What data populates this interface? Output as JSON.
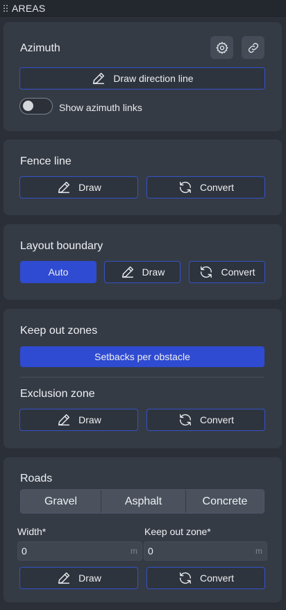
{
  "panel": {
    "title": "AREAS"
  },
  "azimuth": {
    "heading": "Azimuth",
    "draw_label": "Draw direction line",
    "toggle_label": "Show azimuth links",
    "toggle_on": false
  },
  "fence": {
    "heading": "Fence line",
    "draw_label": "Draw",
    "convert_label": "Convert"
  },
  "layout": {
    "heading": "Layout boundary",
    "auto_label": "Auto",
    "draw_label": "Draw",
    "convert_label": "Convert"
  },
  "keepout": {
    "heading": "Keep out zones",
    "setbacks_label": "Setbacks per obstacle"
  },
  "exclusion": {
    "heading": "Exclusion zone",
    "draw_label": "Draw",
    "convert_label": "Convert"
  },
  "roads": {
    "heading": "Roads",
    "types": [
      "Gravel",
      "Asphalt",
      "Concrete"
    ],
    "width_label": "Width*",
    "width_value": "0",
    "width_unit": "m",
    "keepout_label": "Keep out zone*",
    "keepout_value": "0",
    "keepout_unit": "m",
    "draw_label": "Draw",
    "convert_label": "Convert"
  },
  "colors": {
    "accent": "#2f4bd1",
    "border_accent": "#3352c9",
    "card": "#353b45",
    "background": "#2b3038"
  }
}
